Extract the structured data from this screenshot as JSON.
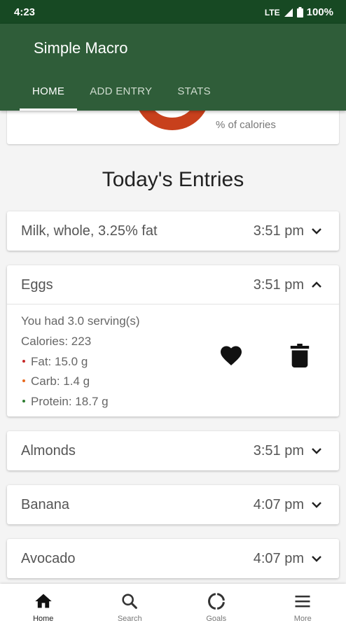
{
  "status_bar": {
    "time": "4:23",
    "network": "LTE",
    "battery": "100%"
  },
  "app": {
    "title": "Simple Macro"
  },
  "tabs": [
    {
      "label": "HOME",
      "active": true
    },
    {
      "label": "ADD ENTRY",
      "active": false
    },
    {
      "label": "STATS",
      "active": false
    }
  ],
  "chart_card": {
    "label": "% of calories",
    "accent": "#c8401c"
  },
  "section_title": "Today's Entries",
  "entries": [
    {
      "name": "Milk, whole,  3.25% fat",
      "time": "3:51 pm",
      "expanded": false
    },
    {
      "name": "Eggs",
      "time": "3:51 pm",
      "expanded": true,
      "details": {
        "servings": "You had 3.0 serving(s)",
        "calories": "Calories: 223",
        "fat": "Fat: 15.0 g",
        "carb": "Carb: 1.4 g",
        "protein": "Protein: 18.7 g"
      }
    },
    {
      "name": "Almonds",
      "time": "3:51 pm",
      "expanded": false
    },
    {
      "name": "Banana",
      "time": "4:07 pm",
      "expanded": false
    },
    {
      "name": "Avocado",
      "time": "4:07 pm",
      "expanded": false
    }
  ],
  "colors": {
    "primary": "#2f5d39",
    "status_bar": "#174923",
    "fat": "#c62828",
    "carb": "#e8691e",
    "protein": "#2e7d32"
  },
  "bottom_nav": [
    {
      "label": "Home",
      "icon": "home-icon",
      "active": true
    },
    {
      "label": "Search",
      "icon": "search-icon",
      "active": false
    },
    {
      "label": "Goals",
      "icon": "goals-icon",
      "active": false
    },
    {
      "label": "More",
      "icon": "menu-icon",
      "active": false
    }
  ]
}
